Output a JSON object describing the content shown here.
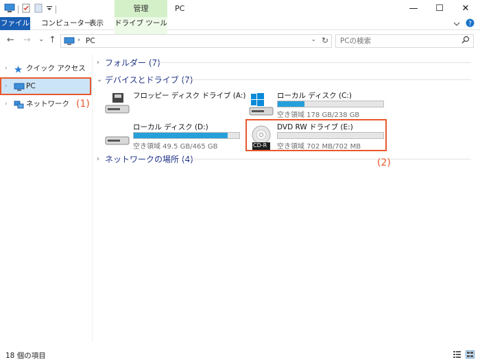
{
  "window": {
    "title": "PC",
    "manage_tab": "管理",
    "minimize": "—",
    "maximize": "☐",
    "close": "✕"
  },
  "ribbon": {
    "tabs": [
      "ファイル",
      "コンピューター",
      "表示",
      "ドライブ ツール"
    ],
    "help": "?"
  },
  "address_bar": {
    "back": "←",
    "forward": "→",
    "recent": "⌄",
    "up": "↑",
    "path_separator": "›",
    "path": "PC",
    "dropdown": "⌄",
    "refresh": "↻"
  },
  "search": {
    "placeholder": "PCの検索",
    "icon": "search-icon"
  },
  "sidebar": {
    "items": [
      {
        "label": "クイック アクセス",
        "icon": "star-icon",
        "chevron": "›"
      },
      {
        "label": "PC",
        "icon": "pc-icon",
        "chevron": "›",
        "selected": true
      },
      {
        "label": "ネットワーク",
        "icon": "network-icon",
        "chevron": "›"
      }
    ]
  },
  "groups": {
    "folders": {
      "label": "フォルダー (7)",
      "chevron": "›"
    },
    "devices": {
      "label": "デバイスとドライブ (7)",
      "chevron": "⌄"
    },
    "network": {
      "label": "ネットワークの場所 (4)",
      "chevron": "›"
    }
  },
  "drives": [
    {
      "name": "フロッピー ディスク ドライブ (A:)",
      "icon": "floppy-drive-icon"
    },
    {
      "name": "ローカル ディスク (C:)",
      "icon": "windows-drive-icon",
      "info": "空き領域 178 GB/238 GB",
      "used_fraction": 0.25
    },
    {
      "name": "ローカル ディスク (D:)",
      "icon": "hard-drive-icon",
      "info": "空き領域 49.5 GB/465 GB",
      "used_fraction": 0.89
    },
    {
      "name": "DVD RW ドライブ (E:)",
      "icon": "cd-drive-icon",
      "badge": "CD-R",
      "info": "空き領域 702 MB/702 MB",
      "used_fraction": 0.0
    }
  ],
  "callouts": {
    "one": "(1)",
    "two": "(2)"
  },
  "status": {
    "items": "18 個の項目"
  },
  "colors": {
    "accent": "#1a5fb4",
    "manage_tab": "#d4f0c8",
    "selection": "#cce4f7",
    "bar_fill": "#26a0da",
    "callout": "#e8572a",
    "group_header": "#1e3287"
  }
}
